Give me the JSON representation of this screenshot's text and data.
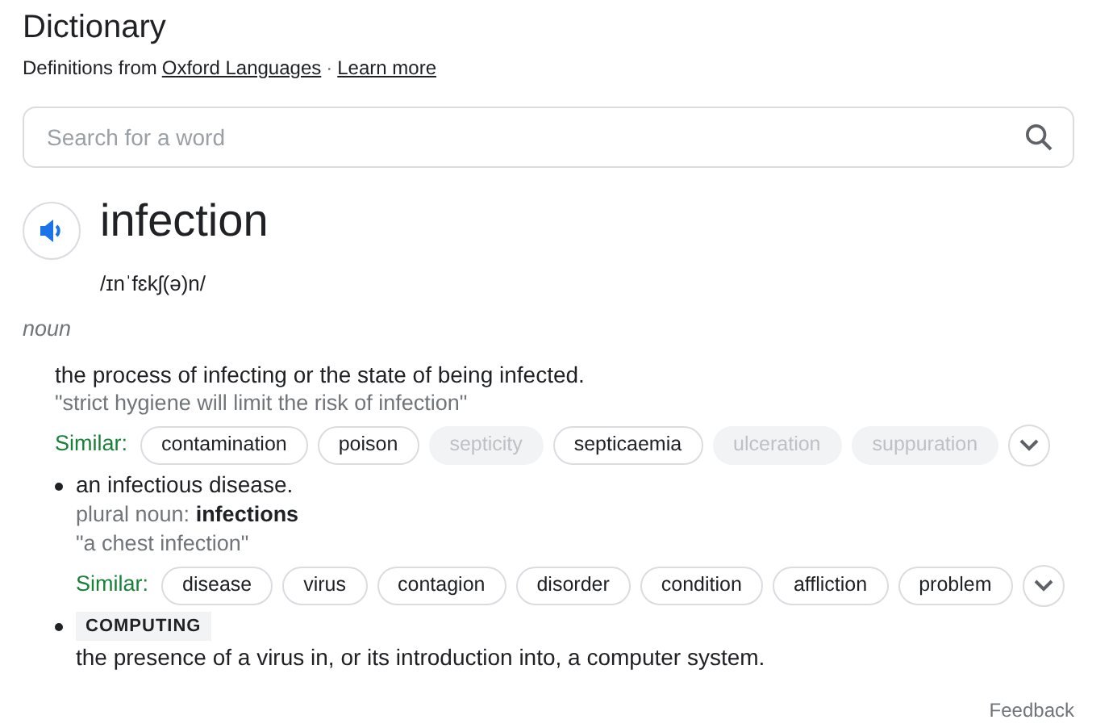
{
  "header": {
    "title": "Dictionary",
    "source_prefix": "Definitions from",
    "source_link": "Oxford Languages",
    "separator": "·",
    "learn_more": "Learn more"
  },
  "search": {
    "placeholder": "Search for a word"
  },
  "entry": {
    "word": "infection",
    "pronunciation": "/ɪnˈfɛkʃ(ə)n/",
    "part_of_speech": "noun"
  },
  "senses": [
    {
      "bullet": false,
      "definition": "the process of infecting or the state of being infected.",
      "example": "\"strict hygiene will limit the risk of infection\"",
      "similar_label": "Similar:",
      "similar": [
        {
          "word": "contamination",
          "disabled": false
        },
        {
          "word": "poison",
          "disabled": false
        },
        {
          "word": "septicity",
          "disabled": true
        },
        {
          "word": "septicaemia",
          "disabled": false
        },
        {
          "word": "ulceration",
          "disabled": true
        },
        {
          "word": "suppuration",
          "disabled": true
        }
      ]
    },
    {
      "bullet": true,
      "definition": "an infectious disease.",
      "grammar": "plural noun: **infections**",
      "example": "\"a chest infection\"",
      "similar_label": "Similar:",
      "similar": [
        {
          "word": "disease",
          "disabled": false
        },
        {
          "word": "virus",
          "disabled": false
        },
        {
          "word": "contagion",
          "disabled": false
        },
        {
          "word": "disorder",
          "disabled": false
        },
        {
          "word": "condition",
          "disabled": false
        },
        {
          "word": "affliction",
          "disabled": false
        },
        {
          "word": "problem",
          "disabled": false
        }
      ]
    },
    {
      "bullet": true,
      "label": "COMPUTING",
      "definition": "the presence of a virus in, or its introduction into, a computer system."
    }
  ],
  "feedback": "Feedback"
}
